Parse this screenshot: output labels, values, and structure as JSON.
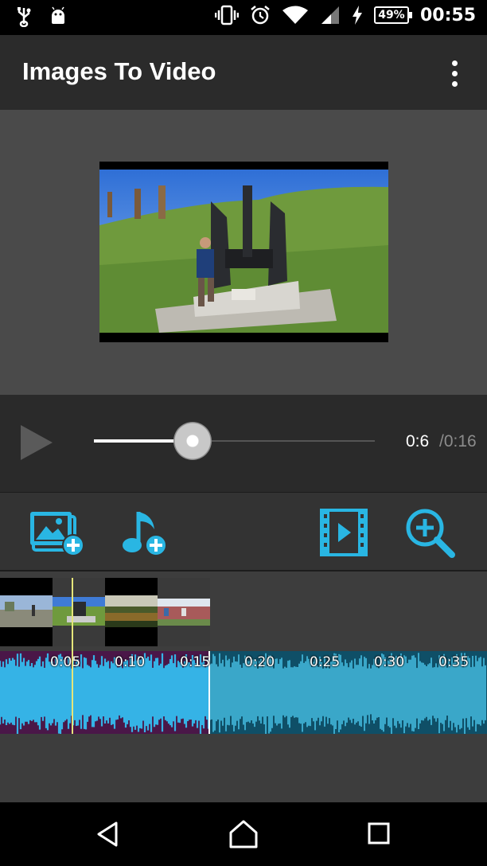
{
  "status_bar": {
    "battery_percent": "49%",
    "time": "00:55",
    "icons": [
      "usb-icon",
      "android-debug-icon",
      "vibrate-icon",
      "alarm-icon",
      "wifi-icon",
      "signal-icon",
      "charging-icon",
      "battery-icon"
    ]
  },
  "app_bar": {
    "title": "Images To Video",
    "menu_icon": "overflow-menu-icon"
  },
  "preview": {
    "image_description_icon": "video-preview-frame"
  },
  "player": {
    "current_time": "0:6",
    "total_time": "/0:16",
    "progress_fraction": 0.35
  },
  "toolbar": {
    "tools": [
      "add-images-icon",
      "add-music-icon",
      "preview-video-icon",
      "zoom-in-icon"
    ],
    "accent_color": "#29b6e3"
  },
  "timeline": {
    "ticks": [
      "0:05",
      "0:10",
      "0:15",
      "0:20",
      "0:25",
      "0:30",
      "0:35"
    ],
    "clips": [
      "clip-1",
      "clip-2",
      "clip-3",
      "clip-4"
    ],
    "audio_selected_end_fraction": 0.43,
    "colors": {
      "selected_wave": "#35b3e6",
      "unselected_wave": "#3aa7c9",
      "selected_bg": "#4a1748"
    }
  },
  "nav_bar": {
    "buttons": [
      "back-icon",
      "home-icon",
      "recents-icon"
    ]
  }
}
